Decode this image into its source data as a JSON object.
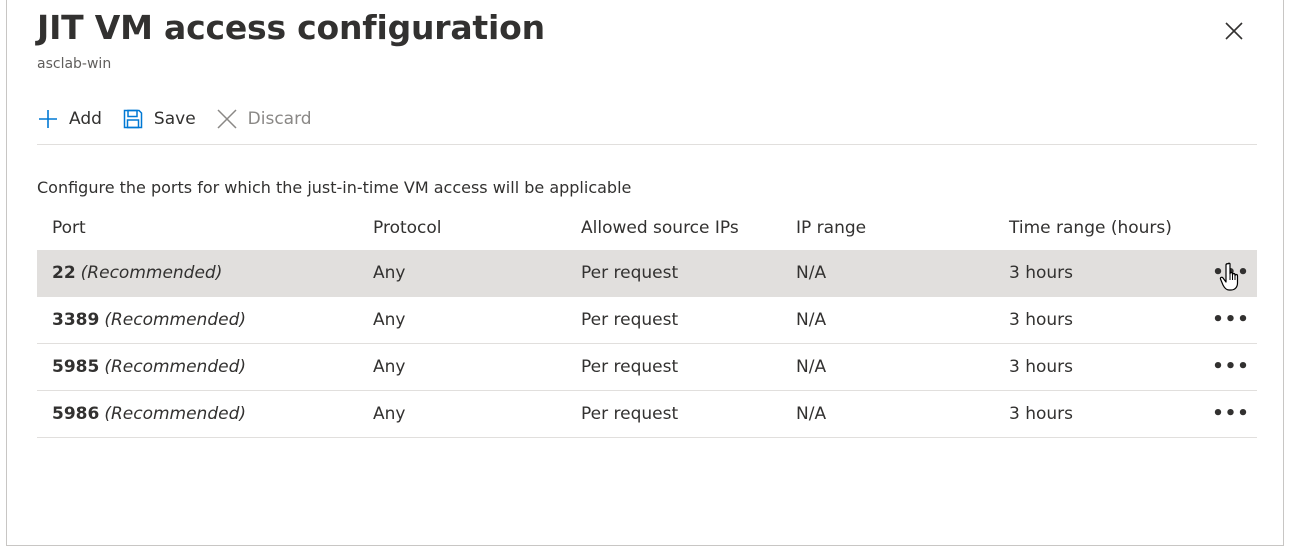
{
  "header": {
    "title": "JIT VM access configuration",
    "subtitle": "asclab-win"
  },
  "toolbar": {
    "add_label": "Add",
    "save_label": "Save",
    "discard_label": "Discard"
  },
  "description": "Configure the ports for which the just-in-time VM access will be applicable",
  "table": {
    "columns": [
      "Port",
      "Protocol",
      "Allowed source IPs",
      "IP range",
      "Time range (hours)"
    ],
    "rows": [
      {
        "port": "22",
        "recommended": "(Recommended)",
        "protocol": "Any",
        "source": "Per request",
        "ip_range": "N/A",
        "time": "3 hours",
        "more": "•••"
      },
      {
        "port": "3389",
        "recommended": "(Recommended)",
        "protocol": "Any",
        "source": "Per request",
        "ip_range": "N/A",
        "time": "3 hours",
        "more": "•••"
      },
      {
        "port": "5985",
        "recommended": "(Recommended)",
        "protocol": "Any",
        "source": "Per request",
        "ip_range": "N/A",
        "time": "3 hours",
        "more": "•••"
      },
      {
        "port": "5986",
        "recommended": "(Recommended)",
        "protocol": "Any",
        "source": "Per request",
        "ip_range": "N/A",
        "time": "3 hours",
        "more": "•••"
      }
    ]
  },
  "icons": {
    "add": "plus-icon",
    "save": "floppy-disk-icon",
    "discard": "x-icon",
    "close": "close-icon",
    "more": "ellipsis-icon",
    "cursor": "hand-pointer-cursor-icon"
  },
  "colors": {
    "accent": "#0078d4",
    "selected_row": "#e1dfdd",
    "disabled_text": "#8a8886"
  }
}
